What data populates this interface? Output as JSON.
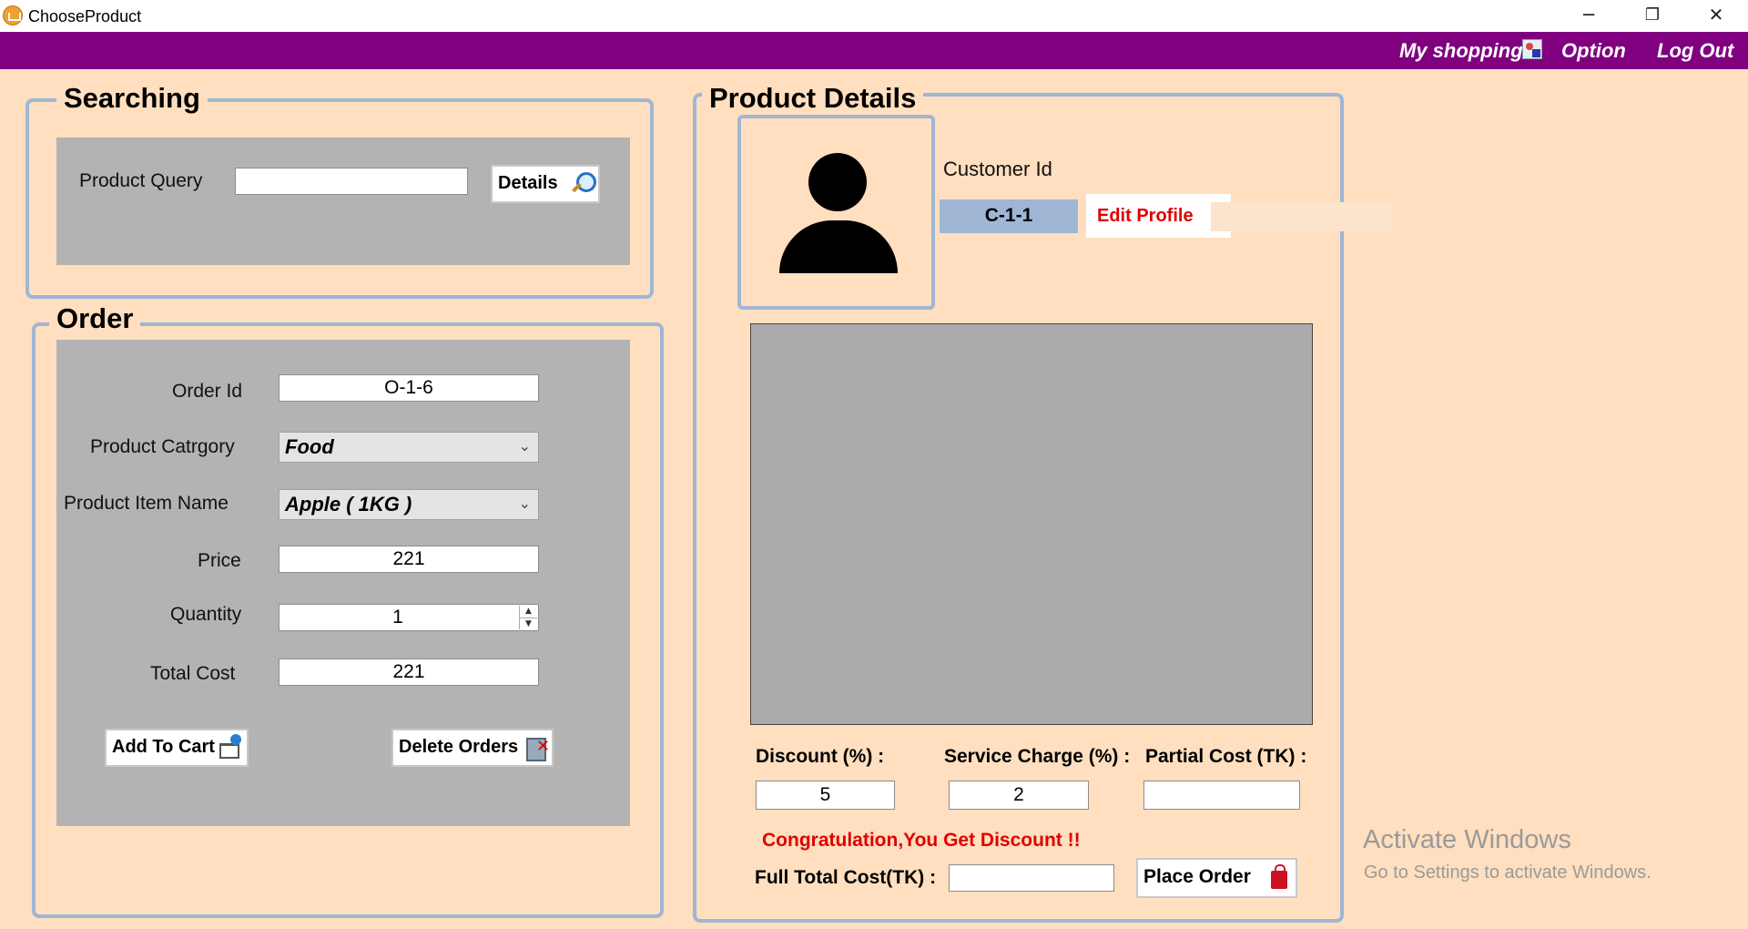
{
  "window": {
    "title": "ChooseProduct",
    "minimize_glyph": "─",
    "restore_glyph": "❐",
    "close_glyph": "✕"
  },
  "menu": {
    "my_shopping": "My shopping",
    "option": "Option",
    "log_out": "Log Out"
  },
  "colors": {
    "menu_bar": "#800080",
    "background": "#ffdfbf",
    "panel": "#b3b3b3",
    "accent_border": "#9fb6d4",
    "alert_text": "#e00000"
  },
  "searching": {
    "title": "Searching",
    "query_label": "Product Query",
    "query_value": "",
    "details_button": "Details"
  },
  "order": {
    "title": "Order",
    "order_id_label": "Order Id",
    "order_id": "O-1-6",
    "category_label": "Product Catrgory",
    "category": "Food",
    "item_label": "Product Item Name",
    "item": "Apple ( 1KG )",
    "price_label": "Price",
    "price": "221",
    "quantity_label": "Quantity",
    "quantity": "1",
    "total_label": "Total Cost",
    "total": "221",
    "add_to_cart": "Add To Cart",
    "delete_orders": "Delete Orders"
  },
  "details": {
    "title": "Product Details",
    "customer_id_label": "Customer Id",
    "customer_id": "C-1-1",
    "edit_profile": "Edit Profile",
    "discount_label": "Discount (%) :",
    "discount": "5",
    "service_label": "Service Charge (%) :",
    "service": "2",
    "partial_label": "Partial Cost (TK) :",
    "partial": "",
    "congrats": "Congratulation,You Get Discount !!",
    "full_total_label": "Full Total Cost(TK) :",
    "full_total": "",
    "place_order": "Place Order"
  },
  "watermark": {
    "line1": "Activate Windows",
    "line2": "Go to Settings to activate Windows."
  }
}
